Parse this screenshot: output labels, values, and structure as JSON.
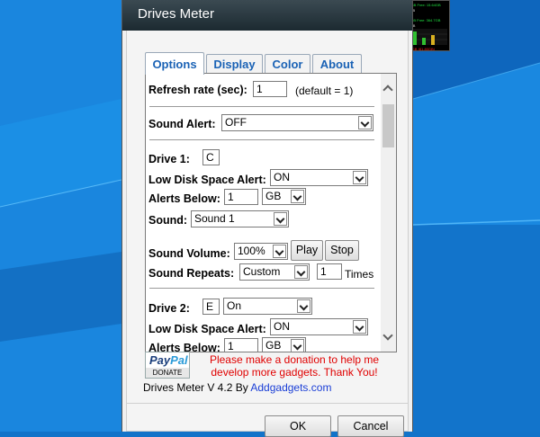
{
  "window": {
    "title": "Drives Meter"
  },
  "tabs": [
    {
      "label": "Options",
      "active": true
    },
    {
      "label": "Display",
      "active": false
    },
    {
      "label": "Color",
      "active": false
    },
    {
      "label": "About",
      "active": false
    }
  ],
  "options": {
    "refresh_label": "Refresh rate (sec):",
    "refresh_value": "1",
    "refresh_default": "(default = 1)",
    "sound_alert_label": "Sound Alert:",
    "sound_alert_value": "OFF",
    "drive1": {
      "label": "Drive 1:",
      "letter": "C",
      "low_disk_label": "Low Disk Space Alert:",
      "low_disk_value": "ON",
      "alerts_below_label": "Alerts Below:",
      "alerts_below_value": "1",
      "unit_value": "GB",
      "sound_label": "Sound:",
      "sound_value": "Sound 1",
      "volume_label": "Sound Volume:",
      "volume_value": "100%",
      "play_label": "Play",
      "stop_label": "Stop",
      "repeats_label": "Sound Repeats:",
      "repeats_mode": "Custom",
      "repeats_count": "1",
      "times_label": "Times"
    },
    "drive2": {
      "label": "Drive 2:",
      "letter": "E",
      "state_value": "On",
      "low_disk_label": "Low Disk Space Alert:",
      "low_disk_value": "ON",
      "alerts_below_label": "Alerts Below:",
      "alerts_below_value": "1",
      "unit_value": "GB"
    }
  },
  "footer": {
    "paypal_brand_1": "Pay",
    "paypal_brand_2": "Pal",
    "paypal_donate": "DONATE",
    "donation_message": "Please make a donation to help me develop more gadgets. Thank You!",
    "version_text": "Drives Meter V 4.2 By ",
    "version_link": "Addgadgets.com",
    "ok_label": "OK",
    "cancel_label": "Cancel"
  },
  "gadget": {
    "line1": "Used: 81.40GB  Free: 15.64GB",
    "line2": "Total: 117.1GB",
    "line3": "Used: 118.3GB  Free: 364.7GB",
    "line4": "Total: 483.0GB",
    "footer": "Total: 600.1GB (81.80GB)"
  },
  "colors": {
    "desktop": "#1273c9",
    "tab_text": "#1a62b5",
    "donation_text": "#e00000",
    "link": "#1a3ed6"
  }
}
